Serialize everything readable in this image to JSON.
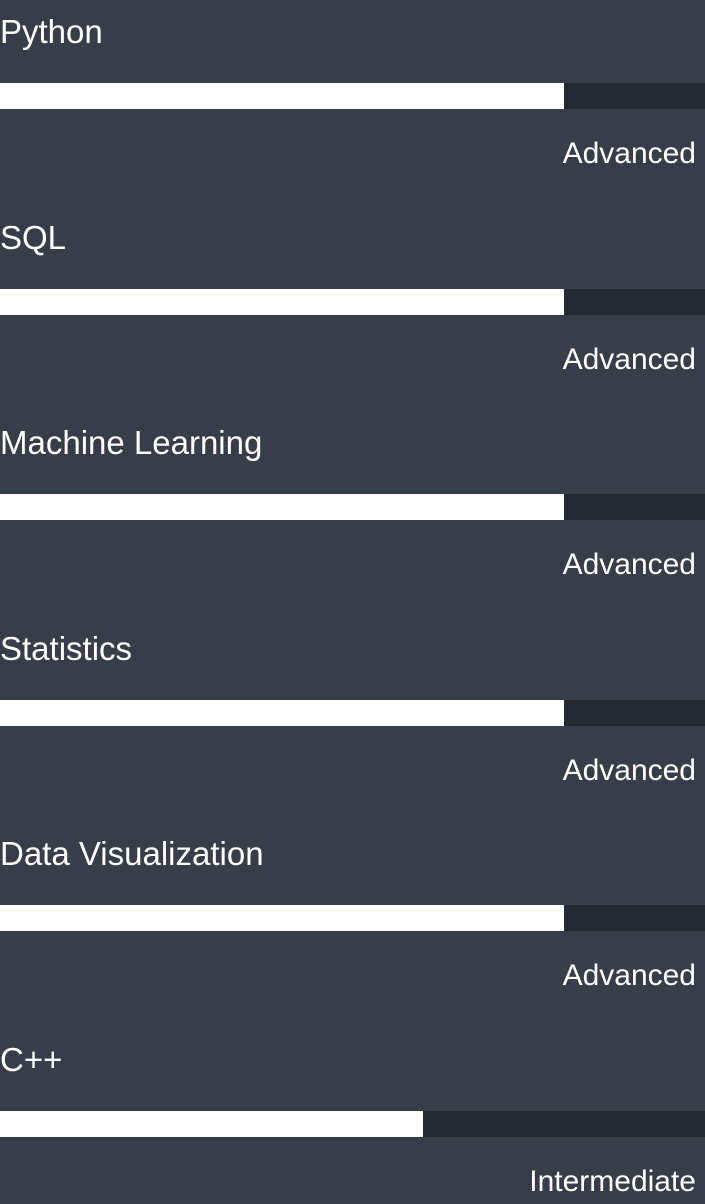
{
  "skills": [
    {
      "name": "Python",
      "level": "Advanced",
      "proficiency": 0.8
    },
    {
      "name": "SQL",
      "level": "Advanced",
      "proficiency": 0.8
    },
    {
      "name": "Machine Learning",
      "level": "Advanced",
      "proficiency": 0.8
    },
    {
      "name": "Statistics",
      "level": "Advanced",
      "proficiency": 0.8
    },
    {
      "name": "Data Visualization",
      "level": "Advanced",
      "proficiency": 0.8
    },
    {
      "name": "C++",
      "level": "Intermediate",
      "proficiency": 0.6
    }
  ],
  "colors": {
    "background": "#383d4a",
    "bar_track": "#252932",
    "bar_fill": "#ffffff",
    "text": "#ffffff"
  }
}
